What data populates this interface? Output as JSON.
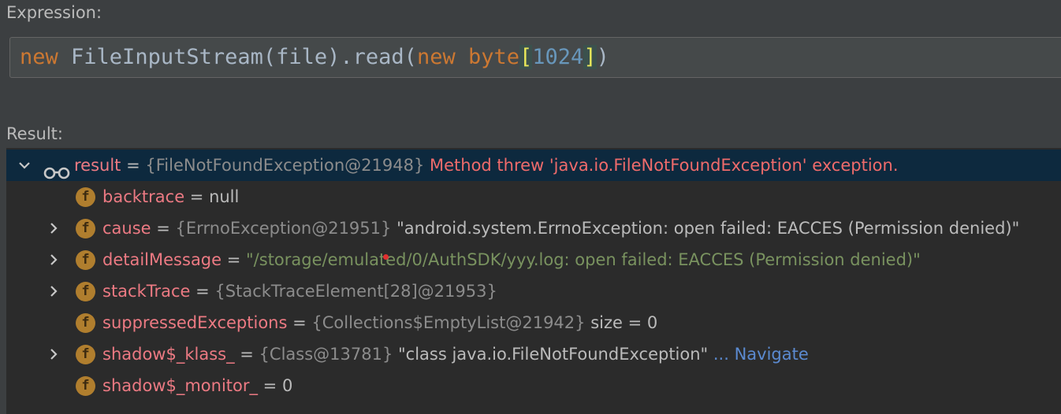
{
  "expression": {
    "label": "Expression:",
    "tokens": {
      "kw_new1": "new",
      "t1": " FileInputStream(file).read(",
      "kw_new2": "new",
      "sp": " ",
      "kw_byte": "byte",
      "lb": "[",
      "num": "1024",
      "rb": "]",
      "close": ")"
    }
  },
  "result": {
    "label": "Result:",
    "root": {
      "name": "result",
      "eq": " = ",
      "type": "{FileNotFoundException@21948}",
      "message": " Method threw 'java.io.FileNotFoundException' exception."
    },
    "children": [
      {
        "name": "backtrace",
        "eq": " = ",
        "type": "",
        "value": "null"
      },
      {
        "name": "cause",
        "eq": " = ",
        "type": "{ErrnoException@21951}",
        "value": " \"android.system.ErrnoException: open failed: EACCES (Permission denied)\""
      },
      {
        "name": "detailMessage",
        "eq": " = ",
        "type": "",
        "value": "\"/storage/emulated/0/AuthSDK/yyy.log: open failed: EACCES (Permission denied)\""
      },
      {
        "name": "stackTrace",
        "eq": " = ",
        "type": "{StackTraceElement[28]@21953}",
        "value": ""
      },
      {
        "name": "suppressedExceptions",
        "eq": " = ",
        "type": "{Collections$EmptyList@21942}",
        "value": "  size = 0"
      },
      {
        "name": "shadow$_klass_",
        "eq": " = ",
        "type": "{Class@13781}",
        "value": " \"class java.io.FileNotFoundException\"",
        "link": " ... Navigate"
      },
      {
        "name": "shadow$_monitor_",
        "eq": " = ",
        "type": "",
        "value": "0"
      }
    ],
    "field_icon_letter": "f"
  }
}
